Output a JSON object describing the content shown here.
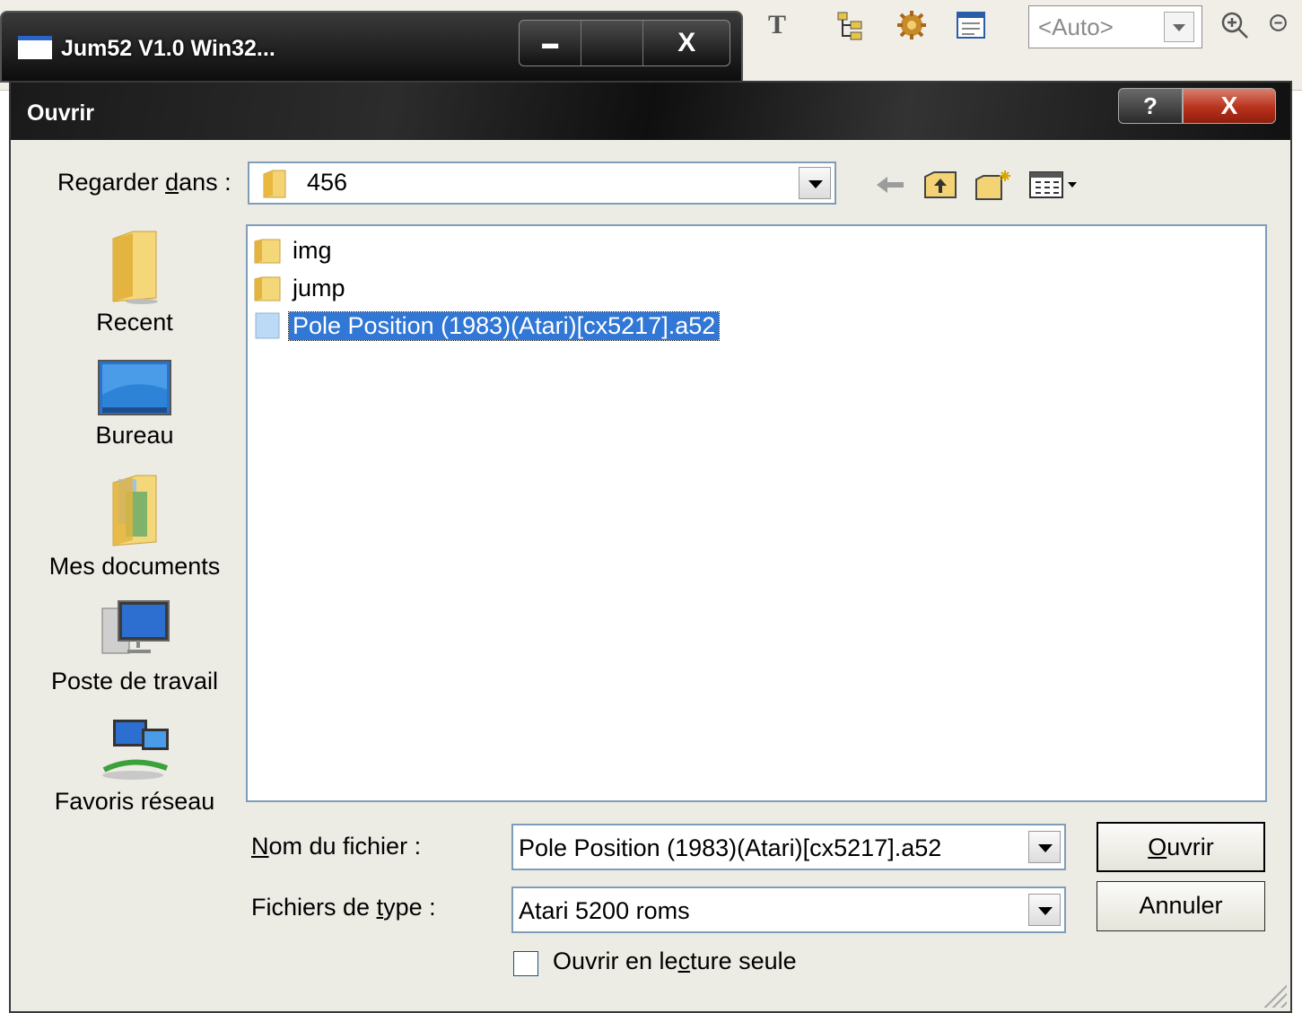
{
  "background_app": {
    "window_title": "Jum52 V1.0 Win32...",
    "window_buttons": {
      "minimize": "▬",
      "close": "X"
    },
    "toolbar": {
      "text_tool_glyph": "T",
      "zoom_combo_value": "<Auto>"
    }
  },
  "dialog": {
    "title": "Ouvrir",
    "help_button": "?",
    "close_button": "X",
    "look_in": {
      "label_pre": "Regarder ",
      "label_accel": "d",
      "label_post": "ans :",
      "value": "456"
    },
    "places": [
      {
        "label": "Recent",
        "icon": "recent-folder-icon"
      },
      {
        "label": "Bureau",
        "icon": "desktop-icon"
      },
      {
        "label": "Mes documents",
        "icon": "my-documents-icon"
      },
      {
        "label": "Poste de travail",
        "icon": "my-computer-icon"
      },
      {
        "label": "Favoris réseau",
        "icon": "network-places-icon"
      }
    ],
    "files": [
      {
        "name": "img",
        "type": "folder"
      },
      {
        "name": "jump",
        "type": "folder"
      },
      {
        "name": "Pole Position (1983)(Atari)[cx5217].a52",
        "type": "file",
        "selected": true
      }
    ],
    "file_name": {
      "label_accel": "N",
      "label_post": "om du fichier :",
      "value": "Pole Position (1983)(Atari)[cx5217].a52"
    },
    "file_type": {
      "label_pre": "Fichiers de ",
      "label_accel": "t",
      "label_post": "ype :",
      "value": "Atari 5200 roms"
    },
    "readonly": {
      "label_pre": "Ouvrir en le",
      "label_accel": "c",
      "label_post": "ture seule",
      "checked": false
    },
    "open_button": {
      "accel": "O",
      "rest": "uvrir"
    },
    "cancel_button": "Annuler"
  },
  "colors": {
    "selection": "#3077d6",
    "dialog_bg": "#ecebe4",
    "titlebar": "#1a1a1a"
  }
}
